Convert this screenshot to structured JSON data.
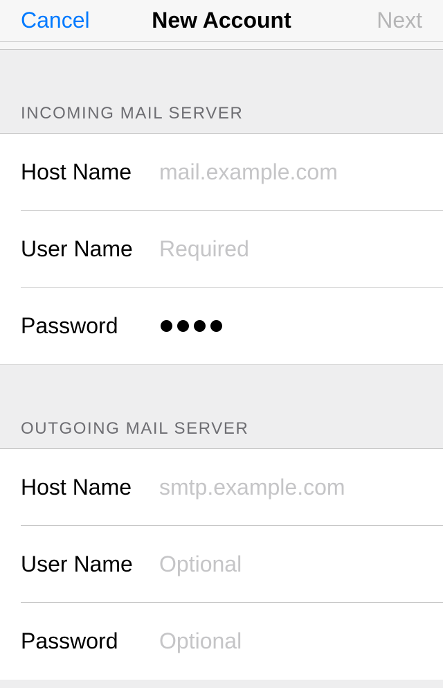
{
  "nav": {
    "cancel": "Cancel",
    "title": "New Account",
    "next": "Next"
  },
  "incoming": {
    "header": "INCOMING MAIL SERVER",
    "hostname_label": "Host Name",
    "hostname_placeholder": "mail.example.com",
    "hostname_value": "",
    "username_label": "User Name",
    "username_placeholder": "Required",
    "username_value": "",
    "password_label": "Password",
    "password_value": "••••"
  },
  "outgoing": {
    "header": "OUTGOING MAIL SERVER",
    "hostname_label": "Host Name",
    "hostname_placeholder": "smtp.example.com",
    "hostname_value": "",
    "username_label": "User Name",
    "username_placeholder": "Optional",
    "username_value": "",
    "password_label": "Password",
    "password_placeholder": "Optional",
    "password_value": ""
  }
}
